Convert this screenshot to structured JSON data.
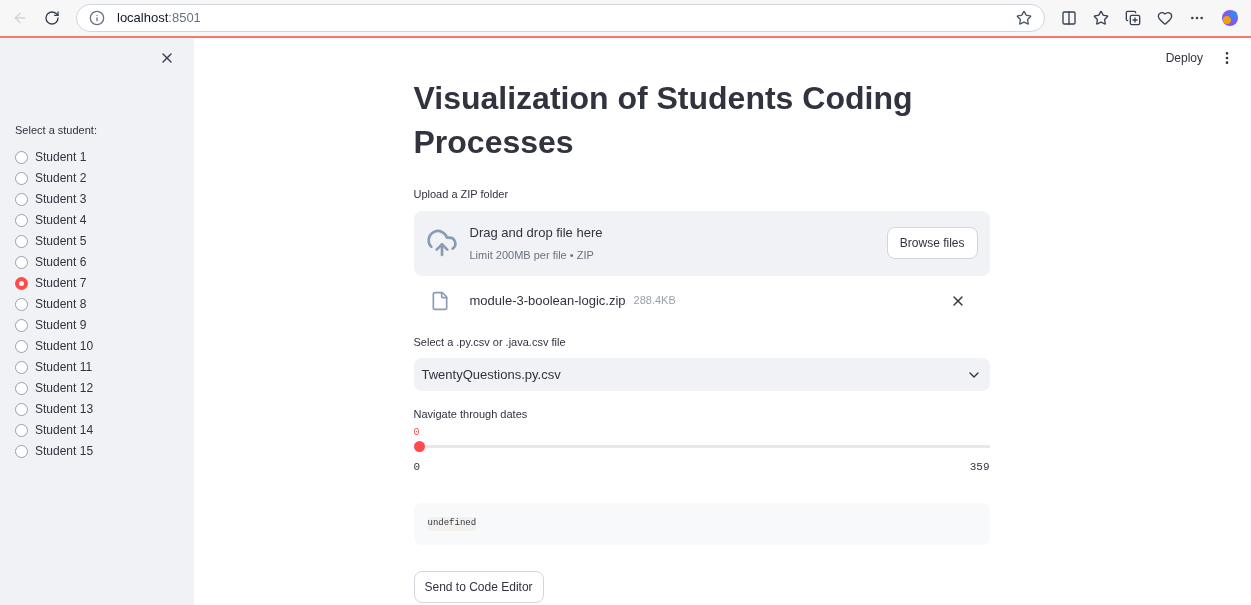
{
  "browser": {
    "url_host": "localhost",
    "url_port": ":8501"
  },
  "header": {
    "deploy": "Deploy"
  },
  "sidebar": {
    "label": "Select a student:",
    "options": [
      {
        "label": "Student 1",
        "selected": false
      },
      {
        "label": "Student 2",
        "selected": false
      },
      {
        "label": "Student 3",
        "selected": false
      },
      {
        "label": "Student 4",
        "selected": false
      },
      {
        "label": "Student 5",
        "selected": false
      },
      {
        "label": "Student 6",
        "selected": false
      },
      {
        "label": "Student 7",
        "selected": true
      },
      {
        "label": "Student 8",
        "selected": false
      },
      {
        "label": "Student 9",
        "selected": false
      },
      {
        "label": "Student 10",
        "selected": false
      },
      {
        "label": "Student 11",
        "selected": false
      },
      {
        "label": "Student 12",
        "selected": false
      },
      {
        "label": "Student 13",
        "selected": false
      },
      {
        "label": "Student 14",
        "selected": false
      },
      {
        "label": "Student 15",
        "selected": false
      }
    ]
  },
  "title": "Visualization of Students Coding Processes",
  "uploader": {
    "label": "Upload a ZIP folder",
    "drop_text": "Drag and drop file here",
    "limit": "Limit 200MB per file • ZIP",
    "button": "Browse files",
    "file": {
      "name": "module-3-boolean-logic.zip",
      "size": "288.4KB"
    }
  },
  "select": {
    "label": "Select a .py.csv or .java.csv file",
    "value": "TwentyQuestions.py.csv"
  },
  "slider": {
    "label": "Navigate through dates",
    "value": "0",
    "level": 0,
    "min": "0",
    "max": "359"
  },
  "code": "undefined",
  "button": "Send to Code Editor"
}
